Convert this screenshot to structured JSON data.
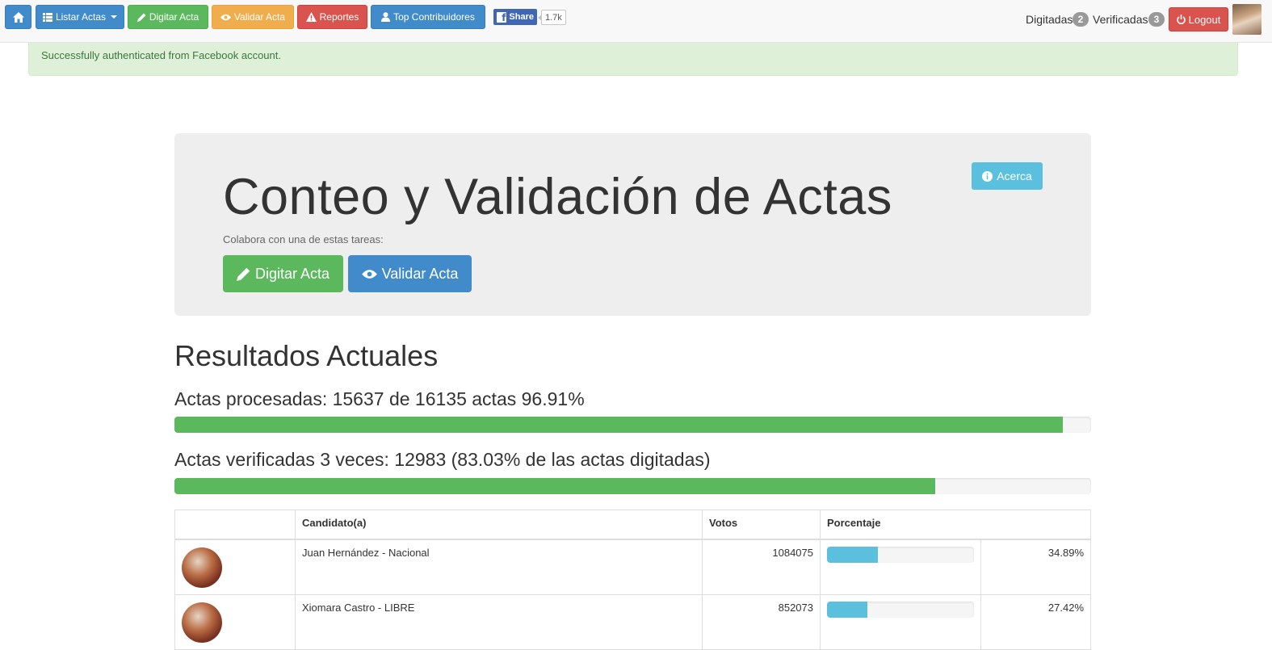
{
  "navbar": {
    "listar_label": "Listar Actas",
    "digitar_label": "Digitar Acta",
    "validar_label": "Validar Acta",
    "reportes_label": "Reportes",
    "top_label": "Top Contribuidores",
    "share_label": "Share",
    "share_count": "1.7k",
    "digitadas_label": "Digitadas",
    "digitadas_count": "2",
    "verificadas_label": "Verificadas",
    "verificadas_count": "3",
    "logout_label": "Logout"
  },
  "alert": {
    "text": "Successfully authenticated from Facebook account."
  },
  "jumbotron": {
    "title": "Conteo y Validación de Actas",
    "subtitle": "Colabora con una de estas tareas:",
    "digitar_label": "Digitar Acta",
    "validar_label": "Validar Acta",
    "acerca_label": "Acerca"
  },
  "results": {
    "title": "Resultados Actuales",
    "processed_text": "Actas procesadas: 15637 de 16135 actas 96.91%",
    "processed_pct": 96.91,
    "verified_text": "Actas verificadas 3 veces: 12983 (83.03% de las actas digitadas)",
    "verified_pct": 83.03
  },
  "table": {
    "headers": {
      "candidate": "Candidato(a)",
      "votes": "Votos",
      "percent": "Porcentaje"
    },
    "rows": [
      {
        "name": "Juan Hernández - Nacional",
        "votes": "1084075",
        "percent": "34.89%",
        "pct": 34.89
      },
      {
        "name": "Xiomara Castro - LIBRE",
        "votes": "852073",
        "percent": "27.42%",
        "pct": 27.42
      }
    ]
  },
  "colors": {
    "primary": "#428bca",
    "success": "#5cb85c",
    "warning": "#f0ad4e",
    "danger": "#d9534f",
    "info": "#5bc0de",
    "alert_bg": "#dff0d8"
  }
}
